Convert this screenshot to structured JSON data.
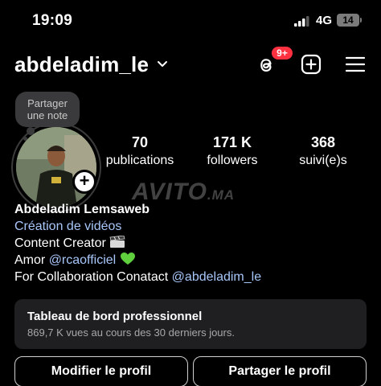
{
  "status_bar": {
    "time": "19:09",
    "network": "4G",
    "battery": "14"
  },
  "header": {
    "username": "abdeladim_le",
    "notification_count": "9+",
    "icons": [
      "chevron-down-icon",
      "threads-icon",
      "plus-square-icon",
      "menu-icon"
    ]
  },
  "note": {
    "line1": "Partager",
    "line2": "une note"
  },
  "stats": {
    "posts_value": "70",
    "posts_label": "publications",
    "followers_value": "171 K",
    "followers_label": "followers",
    "following_value": "368",
    "following_label": "suivi(e)s"
  },
  "watermark": {
    "brand": "AVITO",
    "suffix": ".MA"
  },
  "bio": {
    "name": "Abdeladim Lemsaweb",
    "category": "Création de vidéos",
    "line1": "Content Creator",
    "line2_prefix": "Amor",
    "line2_mention": "@rcaofficiel",
    "line3_prefix": "For Collaboration Conatact",
    "line3_mention": "@abdeladim_le"
  },
  "dashboard": {
    "title": "Tableau de bord professionnel",
    "subtitle": "869,7 K vues au cours des 30 derniers jours."
  },
  "buttons": {
    "edit_profile": "Modifier le profil",
    "share_profile": "Partager le profil"
  },
  "colors": {
    "background": "#000000",
    "link": "#a8c7fa",
    "badge": "#ff3040",
    "card": "#1f1f22",
    "heart": "#5fcf3d"
  }
}
